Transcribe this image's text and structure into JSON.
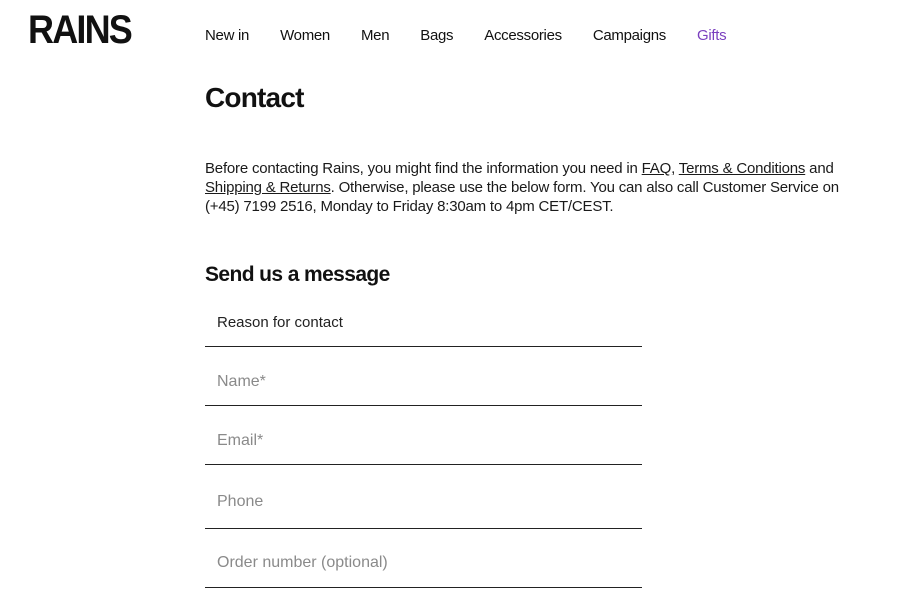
{
  "brand": {
    "logo": "RAINS"
  },
  "nav": {
    "items": [
      {
        "label": "New in"
      },
      {
        "label": "Women"
      },
      {
        "label": "Men"
      },
      {
        "label": "Bags"
      },
      {
        "label": "Accessories"
      },
      {
        "label": "Campaigns"
      },
      {
        "label": "Gifts"
      }
    ],
    "highlight_color": "#7a3fbf"
  },
  "main": {
    "title": "Contact",
    "intro": {
      "part1": "Before contacting Rains, you might find the information you need in ",
      "faq_link": "FAQ",
      "sep1": ", ",
      "terms_link": "Terms & Conditions",
      "sep2": " and ",
      "shipping_link": "Shipping & Returns",
      "part2": ". Otherwise, please use the below form. You can also call Customer Service on (+45) 7199 2516, Monday to Friday 8:30am to 4pm CET/CEST."
    },
    "form": {
      "heading": "Send us a message",
      "reason_label": "Reason for contact",
      "name_placeholder": "Name*",
      "email_placeholder": "Email*",
      "phone_placeholder": "Phone",
      "order_placeholder": "Order number (optional)"
    }
  }
}
